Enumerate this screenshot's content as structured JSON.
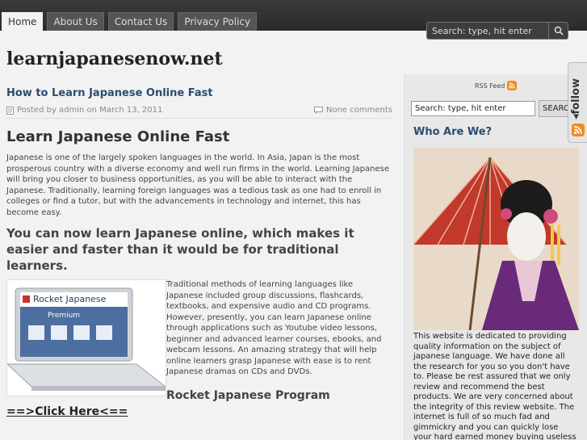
{
  "nav": {
    "items": [
      {
        "label": "Home",
        "active": true
      },
      {
        "label": "About Us",
        "active": false
      },
      {
        "label": "Contact Us",
        "active": false
      },
      {
        "label": "Privacy Policy",
        "active": false
      }
    ]
  },
  "header": {
    "search_placeholder": "Search: type, hit enter",
    "site_title": "learnjapanesenow.net"
  },
  "post": {
    "title": "How to Learn Japanese Online Fast",
    "meta": "Posted by admin on March 13, 2011",
    "comments": "None comments",
    "heading1": "Learn Japanese Online Fast",
    "para1": "Japanese is one of the largely spoken languages in the world.  In Asia, Japan is the most prosperous country with a diverse economy and well run firms in the world. Learning Japanese will bring you closer to business opportunities, as you will be able to interact with the Japanese. Traditionally, learning foreign languages was a tedious task as one had to enroll in colleges or find a tutor, but with the advancements in technology and internet, this has become easy.",
    "heading2": "You can now learn Japanese online, which makes it easier and faster than it would be for traditional learners.",
    "para2": "Traditional methods of learning languages like Japanese included group discussions, flashcards, textbooks, and expensive audio and CD programs. However, presently, you can learn Japanese online through applications such as Youtube video lessons, beginner and advanced learner courses, ebooks, and webcam lessons. An amazing strategy that will help online learners grasp Japanese with ease is to rent Japanese dramas on CDs and DVDs.",
    "heading3": "Rocket Japanese Program",
    "click_here": "==>Click Here<==",
    "product_brand": "Rocket Japanese",
    "product_edition": "Premium"
  },
  "sidebar": {
    "rss_label": "RSS Feed",
    "search_value": "Search: type, hit enter",
    "search_button": "SEARCH",
    "who_title": "Who Are We?",
    "who_text": "This website is dedicated to providing quality information on the subject of japanese language. We have done all the research for you so you don't have to. Please be rest assured that we only review and recommend the best products. We are very concerned about the integrity of this review website. The internet is full of so much fad and gimmickry and you can quickly lose your hard earned money buying useless products.",
    "follow_label": "follow"
  },
  "colors": {
    "topbar": "#2f2f2f",
    "link_heading": "#2a4d6e",
    "rss_orange": "#f28a1e"
  },
  "icons": {
    "search": "search-icon",
    "posted": "document-icon",
    "comments": "comment-icon",
    "rss": "rss-icon"
  }
}
